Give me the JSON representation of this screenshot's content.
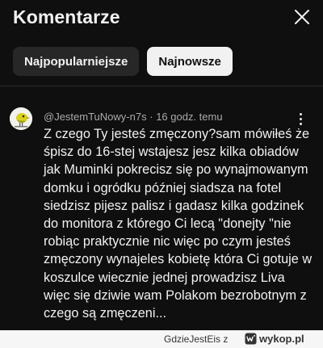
{
  "header": {
    "title": "Komentarze",
    "close_icon": "close-icon"
  },
  "sort_chips": [
    {
      "label": "Najpopularniejsze",
      "selected": false
    },
    {
      "label": "Najnowsze",
      "selected": true
    }
  ],
  "comment": {
    "author": "@JestemTuNowy-n7s",
    "separator": "·",
    "time": "16 godz. temu",
    "menu_icon": "more-vert-icon",
    "text_lines": [
      "Z czego Ty jesteś zmęczony?sam mówiłeś że",
      "śpisz do 16-stej wstajesz jesz kilka obiadów",
      "jak Muminki pokrecisz się po wynajmowanym",
      "domku i ogródku później siadsza na fotel",
      "siedzisz pijesz palisz i gadasz kilka godzinek",
      "do monitora z którego Ci lecą \"donejty \"nie",
      "robiąc praktycznie nic więc po czym jesteś",
      "zmęczony wynajeles kobietę która Ci gotuje w",
      "koszulce wiecznie jednej prowadzisz Liva",
      "więc się dziwie wam Polakom bezrobotnym z",
      "czego są zmęczeni..."
    ]
  },
  "watermark": {
    "user": "GdzieJestEis z",
    "logo_text": "wykop.pl"
  },
  "colors": {
    "background": "#0f0f0f",
    "chip_inactive": "#272727",
    "chip_active": "#f1f1f1",
    "secondary_text": "#aaaaaa"
  }
}
